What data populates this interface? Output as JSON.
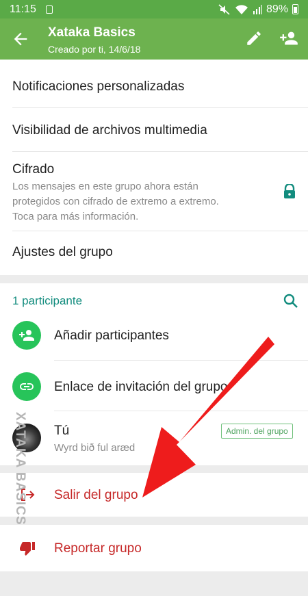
{
  "status_bar": {
    "time": "11:15",
    "battery": "89%"
  },
  "header": {
    "title": "Xataka Basics",
    "subtitle": "Creado por ti, 14/6/18",
    "icons": [
      "back-arrow-icon",
      "pencil-icon",
      "add-person-icon"
    ]
  },
  "settings": {
    "notifications_label": "Notificaciones personalizadas",
    "media_visibility_label": "Visibilidad de archivos multimedia",
    "encryption_title": "Cifrado",
    "encryption_line1": "Los mensajes en este grupo ahora están",
    "encryption_line2": "protegidos con cifrado de extremo a extremo.",
    "encryption_line3": "Toca para más información.",
    "group_settings_label": "Ajustes del grupo"
  },
  "participants": {
    "count_label": "1 participante",
    "add_label": "Añadir participantes",
    "invite_link_label": "Enlace de invitación del grupo",
    "members": [
      {
        "name": "Tú",
        "status": "Wyrd bið ful aræd",
        "badge": "Admin. del grupo"
      }
    ]
  },
  "actions": {
    "exit_label": "Salir del grupo",
    "report_label": "Reportar grupo"
  },
  "watermark": "XATAKA BASICS",
  "colors": {
    "appbar": "#6db24f",
    "statusbar": "#5aaa47",
    "accent": "#128c7e",
    "action_green": "#27c45a",
    "danger": "#c62828",
    "arrow": "#ee1c1c"
  }
}
